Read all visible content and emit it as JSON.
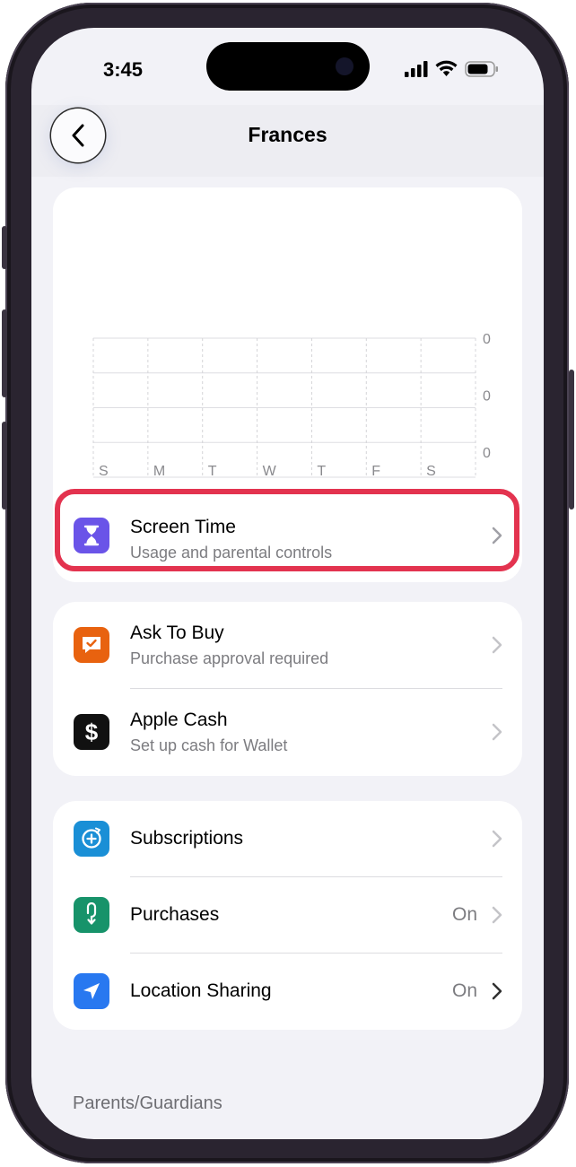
{
  "status_bar": {
    "time": "3:45"
  },
  "nav": {
    "title": "Frances"
  },
  "chart_data": {
    "type": "bar",
    "categories": [
      "S",
      "M",
      "T",
      "W",
      "T",
      "F",
      "S"
    ],
    "values": [
      0,
      0,
      0,
      0,
      0,
      0,
      0
    ],
    "y_tick_labels": [
      "0",
      "0",
      "0"
    ],
    "grid": true
  },
  "screen_time": {
    "title": "Screen Time",
    "subtitle": "Usage and parental controls"
  },
  "group1": [
    {
      "title": "Ask To Buy",
      "subtitle": "Purchase approval required",
      "icon": "ask-to-buy-icon",
      "color": "#e8620f"
    },
    {
      "title": "Apple Cash",
      "subtitle": "Set up cash for Wallet",
      "icon": "dollar-icon",
      "color": "#111111"
    }
  ],
  "group2": [
    {
      "title": "Subscriptions",
      "value": "",
      "icon": "subscriptions-icon",
      "color": "#1a8fd6"
    },
    {
      "title": "Purchases",
      "value": "On",
      "icon": "purchases-icon",
      "color": "#17936a"
    },
    {
      "title": "Location Sharing",
      "value": "On",
      "icon": "location-arrow-icon",
      "color": "#2878f0"
    }
  ],
  "section": {
    "header": "Parents/Guardians"
  },
  "colors": {
    "highlight": "#e3334f",
    "screen_time_icon": "#6a54e8",
    "background": "#f2f2f7"
  }
}
